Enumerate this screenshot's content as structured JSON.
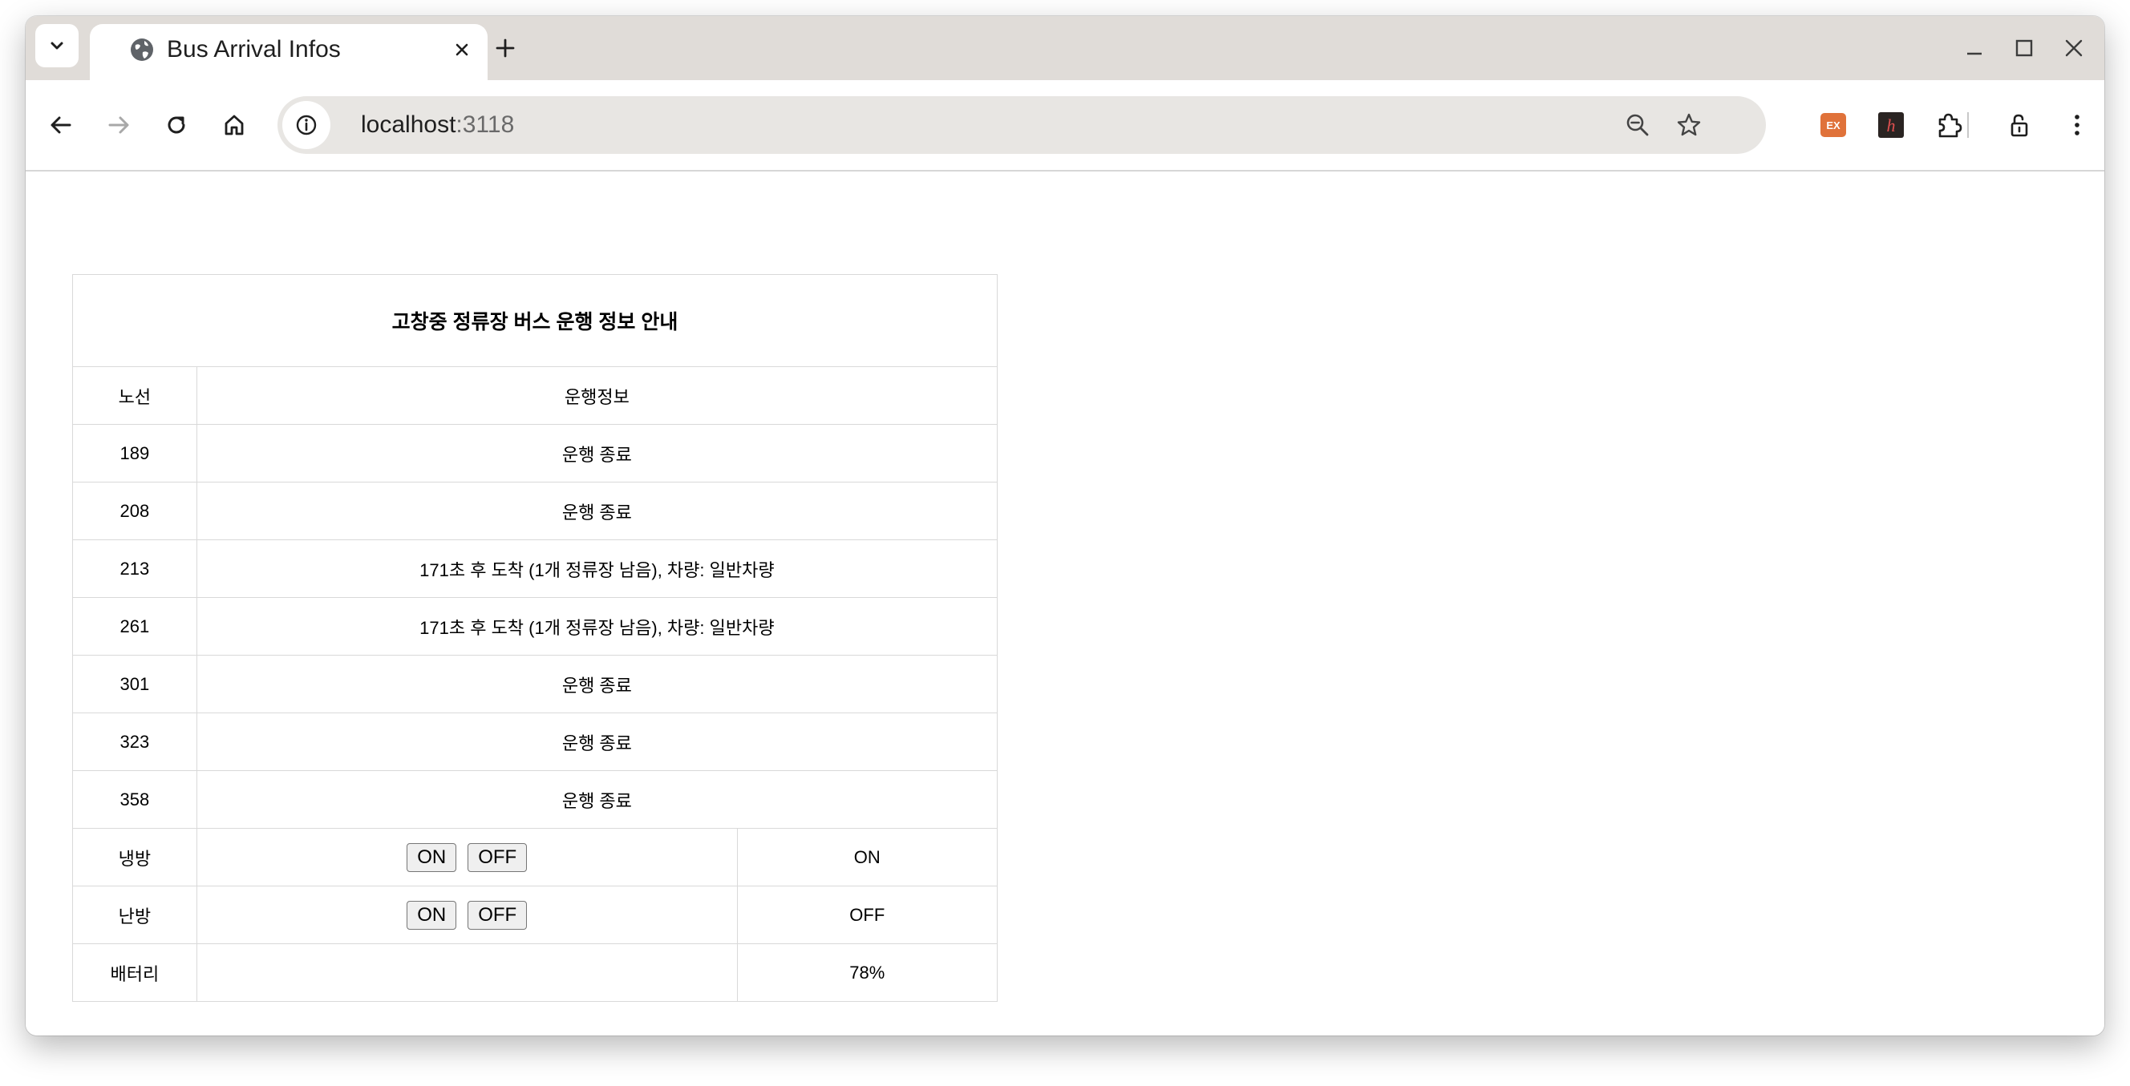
{
  "browser": {
    "tab": {
      "title": "Bus Arrival Infos"
    },
    "address": {
      "host": "localhost",
      "port": ":3118"
    }
  },
  "bus_table": {
    "title": "고창중 정류장 버스 운행 정보 안내",
    "header": {
      "route": "노선",
      "info": "운행정보"
    },
    "rows": [
      {
        "route": "189",
        "info": "운행 종료"
      },
      {
        "route": "208",
        "info": "운행 종료"
      },
      {
        "route": "213",
        "info": "171초 후 도착 (1개 정류장 남음), 차량: 일반차량"
      },
      {
        "route": "261",
        "info": "171초 후 도착 (1개 정류장 남음), 차량: 일반차량"
      },
      {
        "route": "301",
        "info": "운행 종료"
      },
      {
        "route": "323",
        "info": "운행 종료"
      },
      {
        "route": "358",
        "info": "운행 종료"
      }
    ],
    "cooling": {
      "label": "냉방",
      "on_label": "ON",
      "off_label": "OFF",
      "state": "ON"
    },
    "heating": {
      "label": "난방",
      "on_label": "ON",
      "off_label": "OFF",
      "state": "OFF"
    },
    "battery": {
      "label": "배터리",
      "value": "78%"
    }
  },
  "colors": {
    "tabstrip_bg": "#e0dcd8",
    "omnibox_bg": "#e8e6e3",
    "ext_ex_badge": "#e0723a",
    "ext_h_badge": "#2a2422",
    "ext_h_glyph": "#e05050",
    "table_border": "#d9d9d9"
  },
  "icons": {
    "tab_search": "chevron-down-icon",
    "favicon": "globe-icon",
    "tab_close": "close-icon",
    "new_tab": "plus-icon",
    "back": "arrow-left-icon",
    "forward": "arrow-right-icon",
    "reload": "reload-icon",
    "home": "home-icon",
    "site_info": "info-icon",
    "zoom": "zoom-out-icon",
    "bookmark": "star-icon",
    "extensions": "puzzle-icon",
    "lock": "lock-icon",
    "menu": "kebab-menu-icon"
  },
  "extensions": {
    "ex_label": "EX",
    "h_label": "h"
  }
}
